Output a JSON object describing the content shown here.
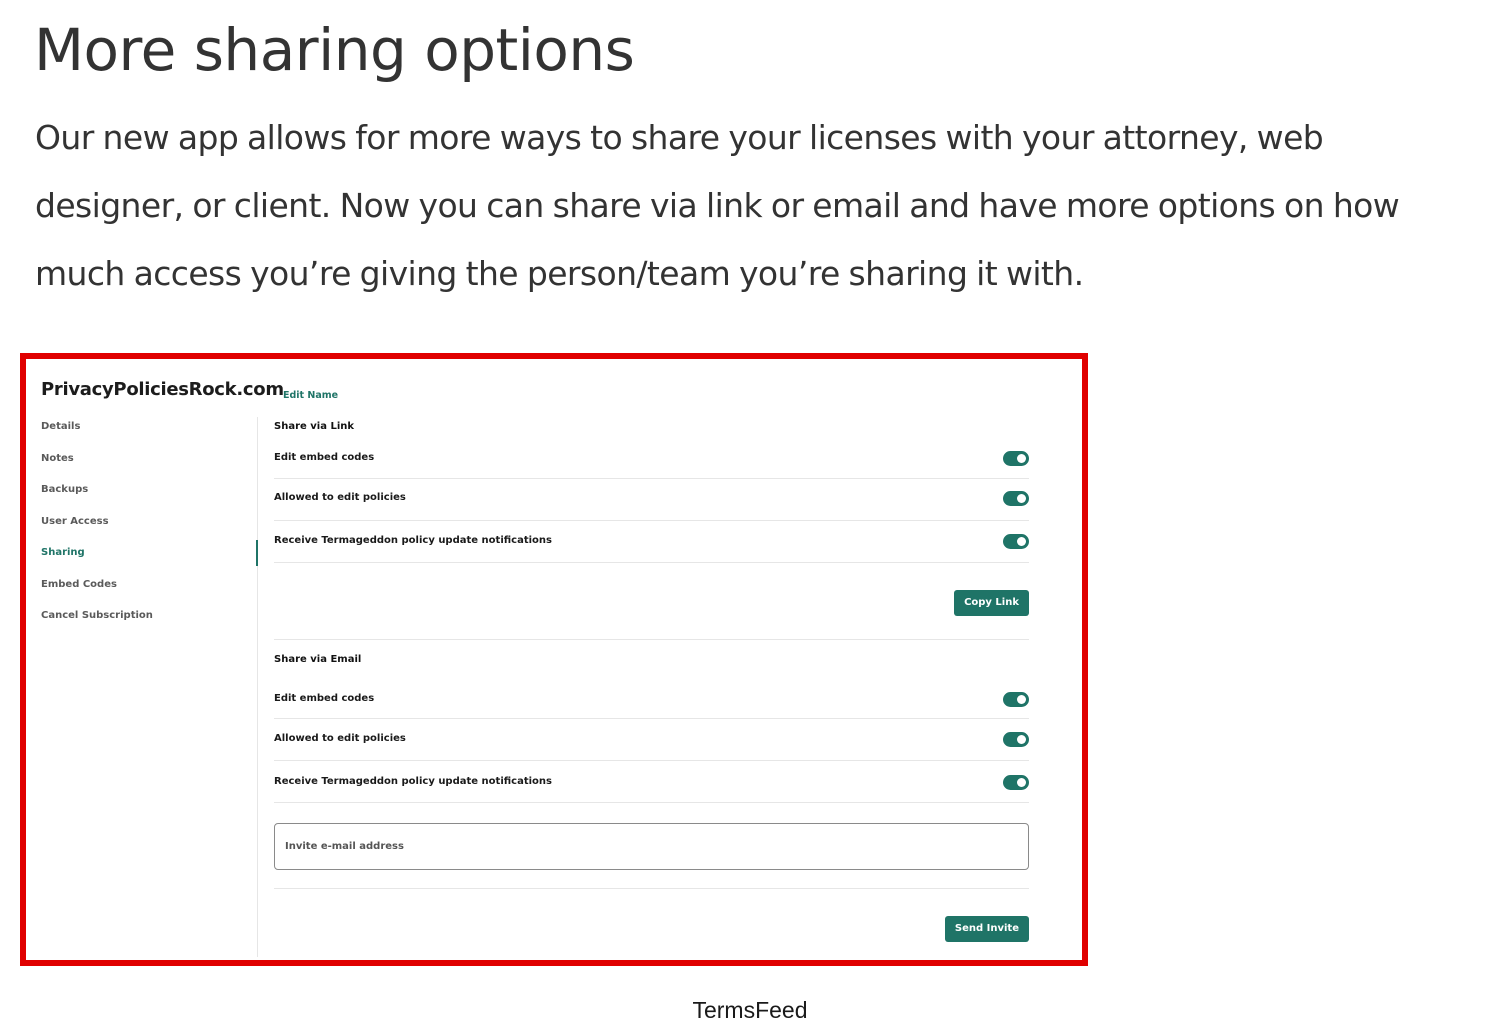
{
  "article": {
    "heading": "More sharing options",
    "intro": "Our new app allows for more ways to share your licenses with your attorney, web designer, or client. Now you can share via link or email and have more options on how much access you’re giving the person/team you’re sharing it with.",
    "caption": "TermsFeed"
  },
  "screenshot": {
    "frame_color": "#e00000",
    "accent_color": "#1f7467",
    "site_title": "PrivacyPoliciesRock.com",
    "edit_name_label": "Edit Name",
    "sidebar": {
      "items": [
        {
          "label": "Details",
          "active": false
        },
        {
          "label": "Notes",
          "active": false
        },
        {
          "label": "Backups",
          "active": false
        },
        {
          "label": "User Access",
          "active": false
        },
        {
          "label": "Sharing",
          "active": true
        },
        {
          "label": "Embed Codes",
          "active": false
        },
        {
          "label": "Cancel Subscription",
          "active": false
        }
      ]
    },
    "share_link": {
      "title": "Share via Link",
      "options": [
        {
          "label": "Edit embed codes",
          "enabled": true
        },
        {
          "label": "Allowed to edit policies",
          "enabled": true
        },
        {
          "label": "Receive Termageddon policy update notifications",
          "enabled": true
        }
      ],
      "button_label": "Copy Link"
    },
    "share_email": {
      "title": "Share via Email",
      "options": [
        {
          "label": "Edit embed codes",
          "enabled": true
        },
        {
          "label": "Allowed to edit policies",
          "enabled": true
        },
        {
          "label": "Receive Termageddon policy update notifications",
          "enabled": true
        }
      ],
      "input_value": "",
      "input_placeholder": "Invite e-mail address",
      "button_label": "Send Invite"
    }
  }
}
